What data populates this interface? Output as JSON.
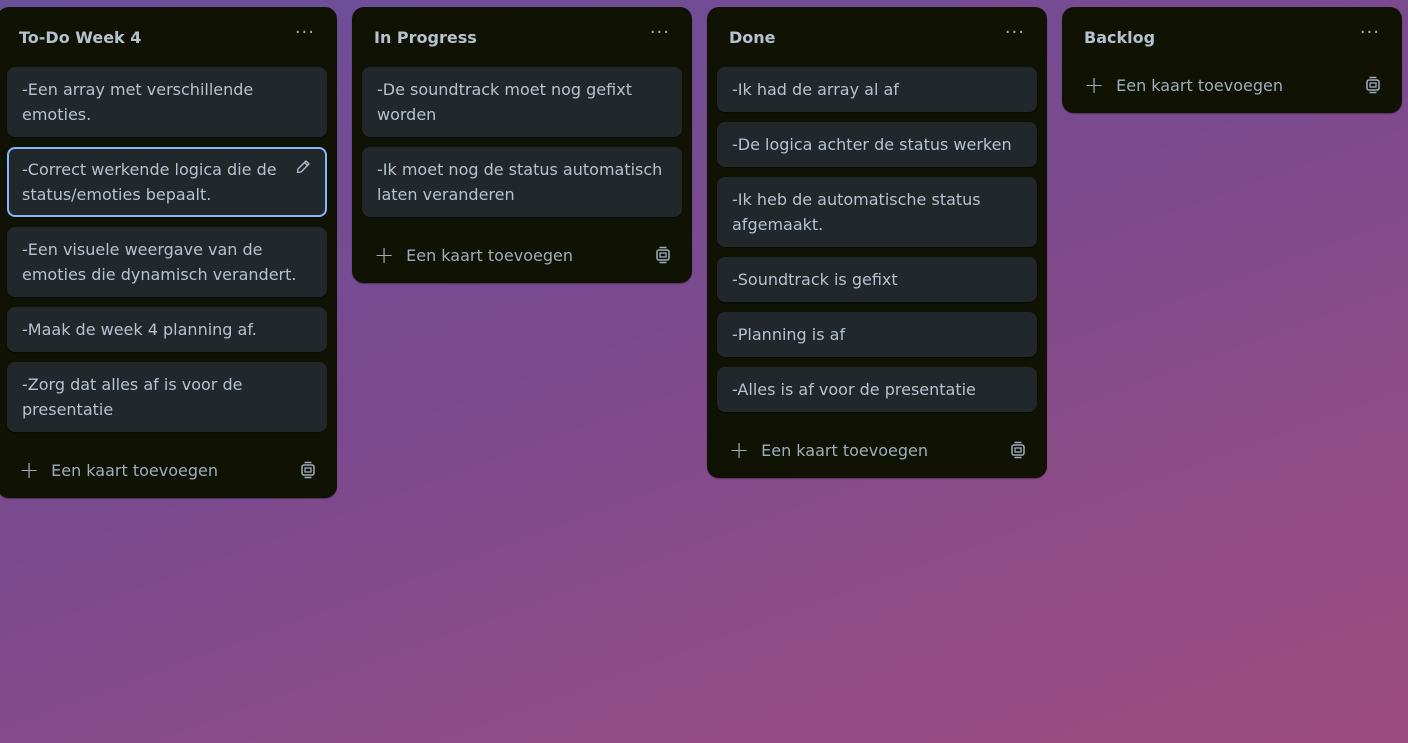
{
  "board": {
    "add_card_label": "Een kaart toevoegen",
    "lists": [
      {
        "title": "To-Do Week 4",
        "cards": [
          "-Een array met verschillende emoties.",
          "-Correct werkende logica die de status/emoties bepaalt.",
          "-Een visuele weergave van de emoties die dynamisch verandert.",
          "-Maak de week 4 planning af.",
          "-Zorg dat alles af is voor de presentatie"
        ]
      },
      {
        "title": "In Progress",
        "cards": [
          "-De soundtrack moet nog gefixt worden",
          "-Ik moet nog de status automatisch laten veranderen"
        ]
      },
      {
        "title": "Done",
        "cards": [
          "-Ik had de array al af",
          "-De logica achter de status werken",
          "-Ik heb de automatische status afgemaakt.",
          "-Soundtrack is gefixt",
          "-Planning is af",
          "-Alles is af voor de presentatie"
        ]
      },
      {
        "title": "Backlog",
        "cards": []
      }
    ]
  },
  "icons": {
    "list_menu": "more-horizontal-icon",
    "add": "plus-icon",
    "template": "card-template-icon",
    "edit": "pencil-icon"
  },
  "colors": {
    "list_background": "#101204",
    "card_background": "#22272b",
    "text": "#b6c2cf",
    "selected_border": "#85b8ff"
  }
}
